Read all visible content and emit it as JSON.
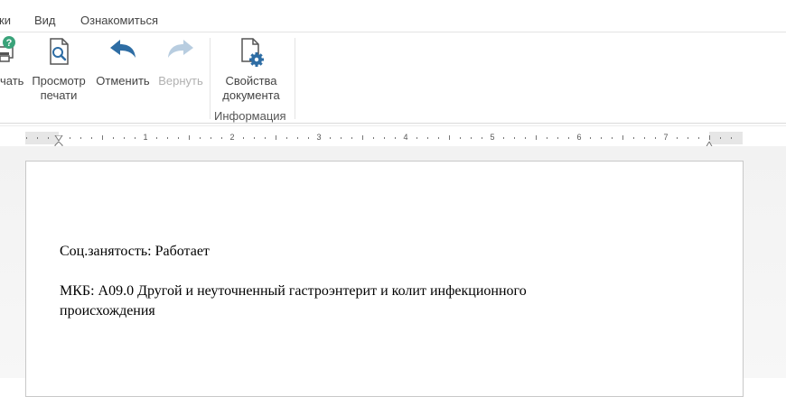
{
  "menu": {
    "item1": "ки",
    "item2": "Вид",
    "item3": "Ознакомиться"
  },
  "ribbon": {
    "print_label": "чать",
    "preview_label": "Просмотр\nпечати",
    "preview_line1": "Просмотр",
    "preview_line2": "печати",
    "undo_label": "Отменить",
    "redo_label": "Вернуть",
    "props_line1": "Свойства",
    "props_line2": "документа",
    "group_info_label": "Информация"
  },
  "ruler": {
    "numbers": [
      "1",
      "2",
      "3",
      "4",
      "5",
      "6",
      "7"
    ]
  },
  "document": {
    "line1": "Соц.занятость: Работает",
    "line2": "МКБ: А09.0 Другой и неуточненный гастроэнтерит и колит инфекционного",
    "line3": "происхождения"
  },
  "colors": {
    "accent_blue": "#2e6da4",
    "disabled": "#b8cde0",
    "help_green": "#3aa37a"
  },
  "icons": [
    "print-icon",
    "help-icon",
    "print-preview-icon",
    "undo-icon",
    "redo-icon",
    "document-properties-icon"
  ]
}
